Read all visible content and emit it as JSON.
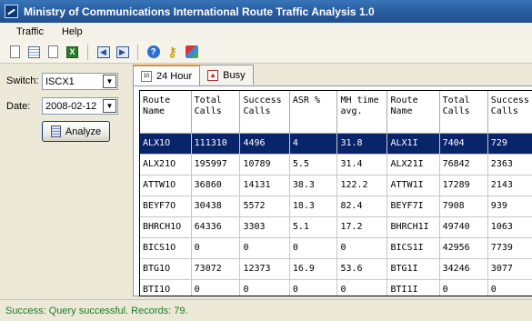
{
  "window": {
    "title": "Ministry of Communications International Route Traffic Analysis 1.0"
  },
  "menu": [
    "Traffic",
    "Help"
  ],
  "toolbar": {
    "icons": [
      "report-icon",
      "table-icon",
      "new-document-icon",
      "excel-icon",
      "back-icon",
      "forward-icon",
      "help-icon",
      "key-icon",
      "cube-icon"
    ],
    "excel_glyph": "X",
    "help_glyph": "?",
    "key_glyph": "⚷"
  },
  "filters": {
    "switch_label": "Switch:",
    "switch_value": "ISCX1",
    "date_label": "Date:",
    "date_value": "2008-02-12",
    "analyze_label": "Analyze"
  },
  "tabs": [
    {
      "label": "24 Hour",
      "active": true
    },
    {
      "label": "Busy",
      "active": false
    }
  ],
  "table": {
    "columns": [
      "Route Name",
      "Total Calls",
      "Success Calls",
      "ASR %",
      "MH time avg.",
      "Route Name",
      "Total Calls",
      "Success Calls"
    ],
    "rows": [
      [
        "ALX1O",
        "111310",
        "4496",
        "4",
        "31.8",
        "ALX1I",
        "7404",
        "729"
      ],
      [
        "ALX21O",
        "195997",
        "10789",
        "5.5",
        "31.4",
        "ALX21I",
        "76842",
        "2363"
      ],
      [
        "ATTW1O",
        "36860",
        "14131",
        "38.3",
        "122.2",
        "ATTW1I",
        "17289",
        "2143"
      ],
      [
        "BEYF7O",
        "30438",
        "5572",
        "18.3",
        "82.4",
        "BEYF7I",
        "7908",
        "939"
      ],
      [
        "BHRCH1O",
        "64336",
        "3303",
        "5.1",
        "17.2",
        "BHRCH1I",
        "49740",
        "1063"
      ],
      [
        "BICS1O",
        "0",
        "0",
        "0",
        "0",
        "BICS1I",
        "42956",
        "7739"
      ],
      [
        "BTG1O",
        "73072",
        "12373",
        "16.9",
        "53.6",
        "BTG1I",
        "34246",
        "3077"
      ],
      [
        "BTI1O",
        "0",
        "0",
        "0",
        "0",
        "BTI1I",
        "0",
        "0"
      ]
    ],
    "selected_row": 0
  },
  "status": {
    "text": "Success: Query successful. Records: 79."
  },
  "colors": {
    "selection": "#0a246a",
    "status_text": "#1f7a1f",
    "title_bar": "#2a5fa3"
  }
}
